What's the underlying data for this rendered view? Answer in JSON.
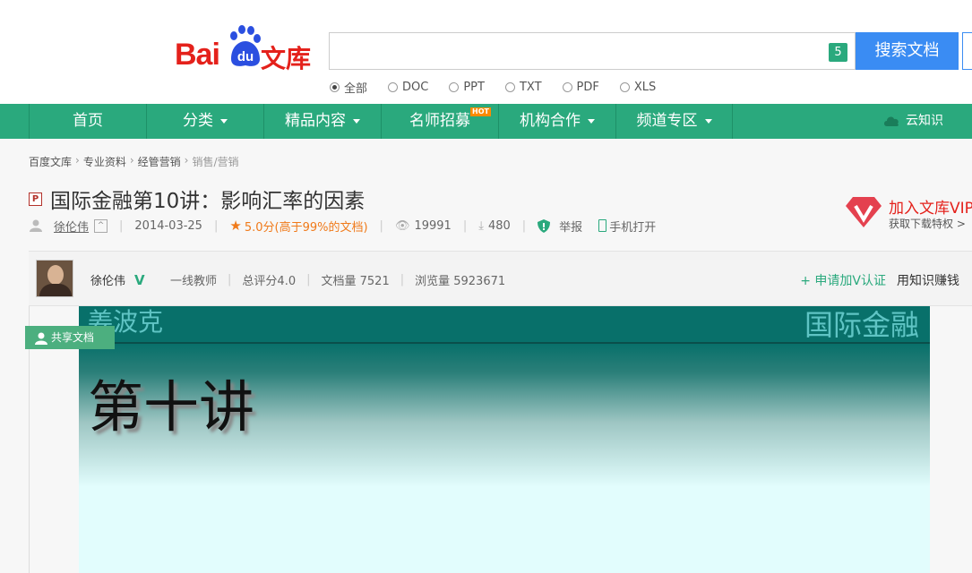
{
  "logo": {
    "bai": "Bai",
    "du": "du",
    "wenku": "文库"
  },
  "search": {
    "value": "",
    "badge": "5",
    "button": "搜索文档"
  },
  "filters": [
    {
      "label": "全部",
      "checked": true
    },
    {
      "label": "DOC",
      "checked": false
    },
    {
      "label": "PPT",
      "checked": false
    },
    {
      "label": "TXT",
      "checked": false
    },
    {
      "label": "PDF",
      "checked": false
    },
    {
      "label": "XLS",
      "checked": false
    }
  ],
  "nav": {
    "items": [
      "首页",
      "分类",
      "精品内容",
      "名师招募",
      "机构合作",
      "频道专区"
    ],
    "hot": "HOT",
    "cloud": "云知识"
  },
  "breadcrumb": [
    "百度文库",
    "专业资料",
    "经管营销",
    "销售/营销"
  ],
  "doc": {
    "type_icon": "P",
    "title": "国际金融第10讲：影响汇率的因素",
    "author": "徐伦伟",
    "date": "2014-03-25",
    "rating": "5.0分",
    "rating_note": "(高于99%的文档)",
    "views": "19991",
    "downloads": "480",
    "report": "举报",
    "mobile": "手机打开"
  },
  "vip": {
    "title": "加入文库VIP",
    "subtitle": "获取下载特权 >"
  },
  "author_bar": {
    "name": "徐伦伟",
    "role": "一线教师",
    "score": "总评分4.0",
    "doc_count": "文档量 7521",
    "view_count": "浏览量 5923671",
    "apply_v": "+ 申请加V认证",
    "earn": "用知识赚钱"
  },
  "share_tag": "共享文档",
  "page": {
    "left": "姜波克",
    "right": "国际金融",
    "heading": "第十讲"
  },
  "colors": {
    "green": "#2aa97d",
    "red": "#e4211b",
    "blue": "#3a8cf3"
  }
}
